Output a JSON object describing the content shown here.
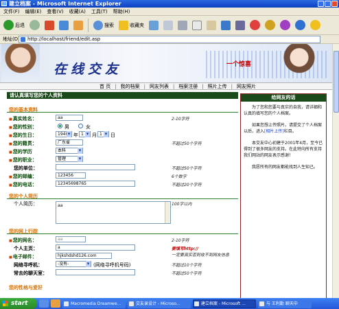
{
  "window": {
    "title": "建立档案 - Microsoft Internet Explorer"
  },
  "menu": [
    "文件(F)",
    "编辑(E)",
    "查看(V)",
    "收藏(A)",
    "工具(T)",
    "帮助(H)"
  ],
  "toolbar": {
    "back": "后退",
    "search": "搜索",
    "favorites": "收藏夹"
  },
  "address": {
    "label": "地址(D)",
    "url": "http://localhost/friend/edit.asp"
  },
  "banner": {
    "title": "在线交友",
    "promo": "一个惊喜"
  },
  "nav": [
    "首 页",
    "我的档案",
    "网友列表",
    "档案注册",
    "照片上传",
    "网友照片"
  ],
  "form": {
    "header": "请认真填写您的个人资料",
    "basic_title": "您的基本资料",
    "fields": {
      "realname": {
        "label": "真实姓名：",
        "value": "aa",
        "hint": "2-10字符"
      },
      "gender": {
        "label": "您的性别：",
        "male": "男",
        "female": "女"
      },
      "birthday": {
        "label": "您的生日：",
        "year": "1940",
        "year_unit": "年",
        "month": "1",
        "month_unit": "月",
        "day": "1",
        "day_unit": "日"
      },
      "hometown": {
        "label": "您的籍贯：",
        "value": "广东省",
        "hint": "不超过50个字符"
      },
      "education": {
        "label": "您的学历",
        "value": "本科"
      },
      "job": {
        "label": "您的职业：",
        "value": "管理"
      },
      "company": {
        "label": "您的单位：",
        "value": "",
        "hint": "不超过50个字符"
      },
      "postcode": {
        "label": "您的邮编：",
        "value": "123456",
        "hint": "6个数字"
      },
      "phone": {
        "label": "您的电话：",
        "value": "12345698765",
        "hint": "不超过20个字符"
      }
    },
    "intro_title": "您的个人简历",
    "intro": {
      "label": "个人简历：",
      "value": "aa",
      "hint": "100字以内"
    },
    "online_title": "您的网上行踪",
    "online": {
      "netname": {
        "label": "您的网名：",
        "value": "aa",
        "hint": "2-10字符"
      },
      "homepage": {
        "label": "个人主页：",
        "value": "a",
        "hint": "要填写http://"
      },
      "email": {
        "label": "电子邮件：",
        "value": "hjkshdshd126.com",
        "hint": "一定要真实否则收不到网友信息"
      },
      "pager": {
        "label": "网络寻呼机：",
        "value": "-没有-",
        "after": "(网络寻呼机号码)",
        "hint": "不超过10个字符"
      },
      "chatroom": {
        "label": "常去的聊天室：",
        "value": "",
        "hint": "不超过50个字符"
      }
    },
    "hobby_title": "您的性格与爱好"
  },
  "sidebar": {
    "title": "给网友的话",
    "p1": "为了您和您要与真实的自我，请详细和认真的填写您的个人档案。",
    "p2a": "如果您想上传照片，请提交了个人档案以后，进入",
    "p2link": "[相片上传]",
    "p2b": "栏目。",
    "p3": "本交友中心初建于2001年4月，至今已得到了很多网友的支持。在此特向所有支持我们网站的网友表示感谢！",
    "p4": "我愿所有的网友都能找到人生知己。"
  },
  "taskbar": {
    "start": "start",
    "tasks": [
      "Macromedia Dreamwe...",
      "交友录设计 - Microso...",
      "建立档案 - Microsoft ...",
      "与 王利勤 聊天中"
    ]
  }
}
